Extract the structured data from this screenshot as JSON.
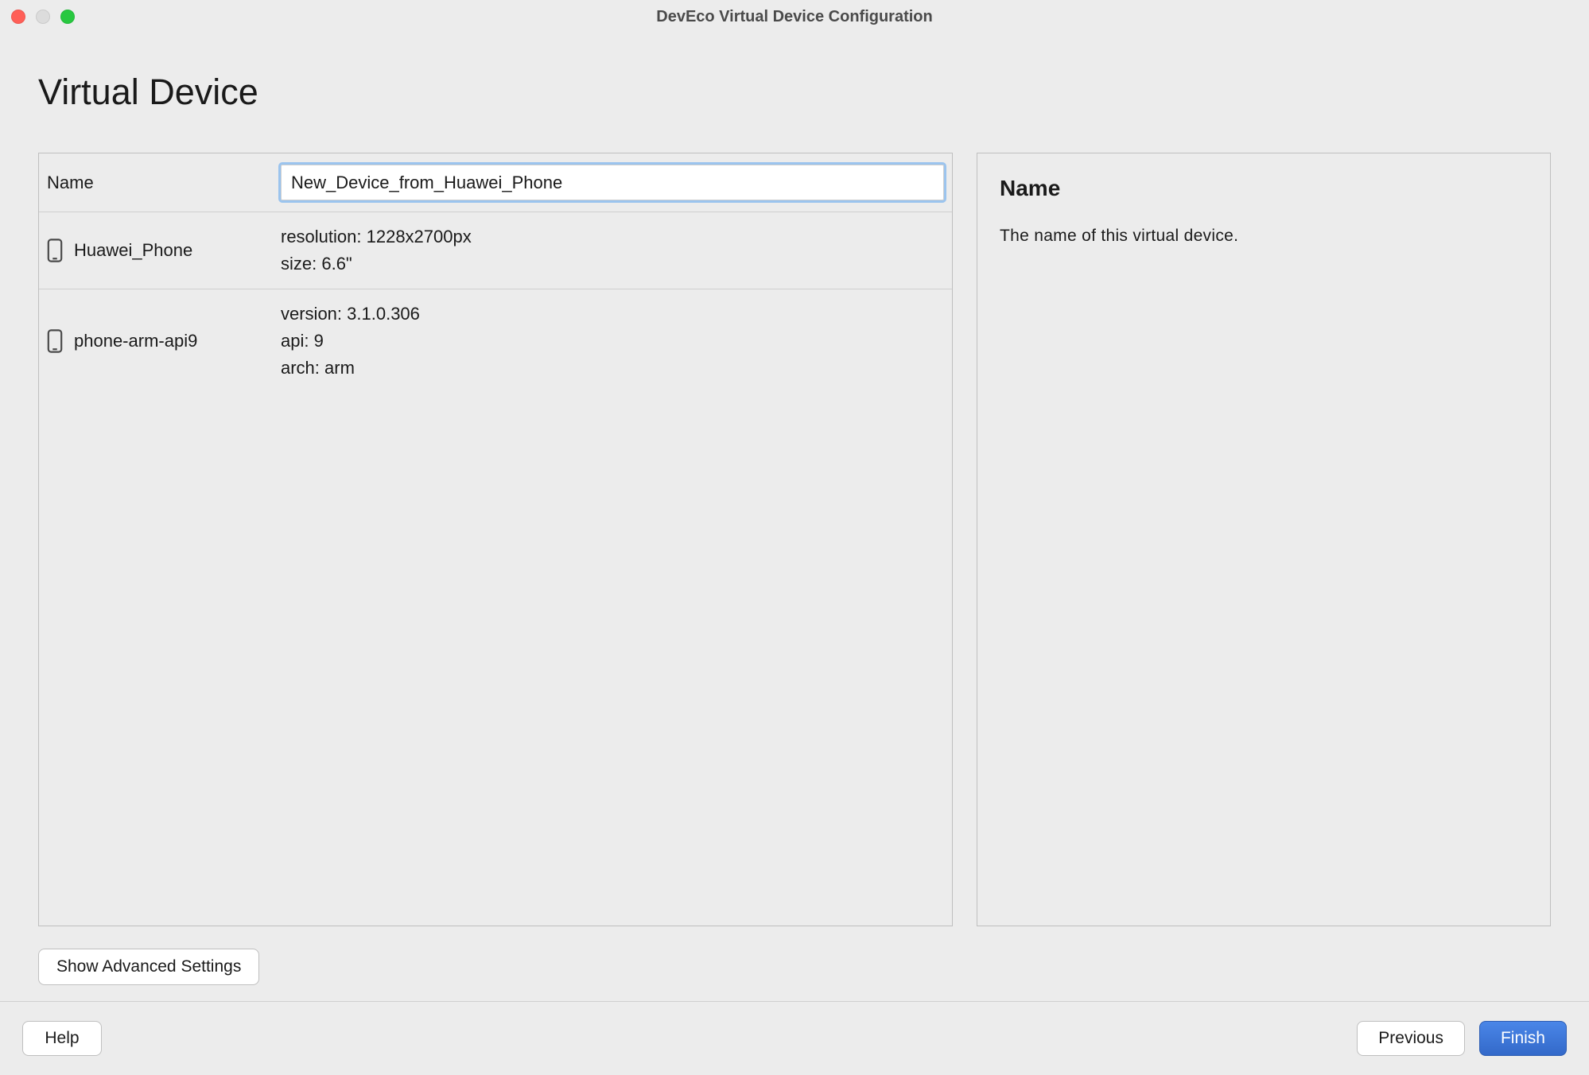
{
  "window": {
    "title": "DevEco Virtual Device Configuration"
  },
  "page": {
    "heading": "Virtual Device"
  },
  "form": {
    "name_label": "Name",
    "name_value": "New_Device_from_Huawei_Phone",
    "device_rows": [
      {
        "label": "Huawei_Phone",
        "details": "resolution: 1228x2700px\nsize: 6.6\""
      },
      {
        "label": "phone-arm-api9",
        "details": "version: 3.1.0.306\napi: 9\narch: arm"
      }
    ]
  },
  "info_panel": {
    "title": "Name",
    "description": "The name of this virtual device."
  },
  "buttons": {
    "advanced": "Show Advanced Settings",
    "help": "Help",
    "previous": "Previous",
    "finish": "Finish"
  }
}
